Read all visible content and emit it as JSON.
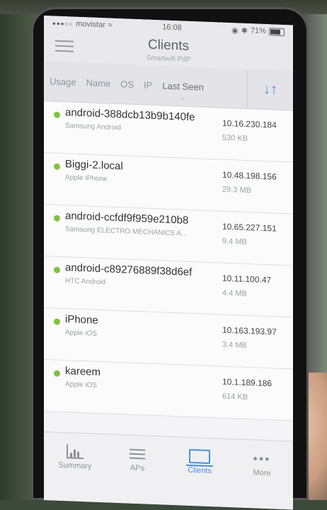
{
  "status": {
    "carrier": "movistar",
    "time": "16:08",
    "battery": "71%"
  },
  "header": {
    "title": "Clients",
    "subtitle": "Smartwifi PdP"
  },
  "sort_tabs": [
    "Usage",
    "Name",
    "OS",
    "IP",
    "Last Seen"
  ],
  "clients": [
    {
      "name": "android-388dcb13b9b140fe",
      "model": "Samsung Android",
      "ip": "10.16.230.184",
      "usage": "530 KB"
    },
    {
      "name": "Biggi-2.local",
      "model": "Apple iPhone",
      "ip": "10.48.198.156",
      "usage": "29.3 MB"
    },
    {
      "name": "android-ccfdf9f959e210b8",
      "model": "Samsung ELECTRO MECHANICS A...",
      "ip": "10.65.227.151",
      "usage": "9.4 MB"
    },
    {
      "name": "android-c89276889f38d6ef",
      "model": "HTC Android",
      "ip": "10.11.100.47",
      "usage": "4.4 MB"
    },
    {
      "name": "iPhone",
      "model": "Apple iOS",
      "ip": "10.163.193.97",
      "usage": "3.4 MB"
    },
    {
      "name": "kareem",
      "model": "Apple iOS",
      "ip": "10.1.189.186",
      "usage": "614 KB"
    }
  ],
  "tabbar": [
    {
      "label": "Summary",
      "icon": "bar-chart-icon"
    },
    {
      "label": "APs",
      "icon": "list-icon"
    },
    {
      "label": "Clients",
      "icon": "laptop-icon"
    },
    {
      "label": "More",
      "icon": "ellipsis-icon"
    }
  ],
  "colors": {
    "accent": "#4a8fd8",
    "online": "#7fc243"
  }
}
